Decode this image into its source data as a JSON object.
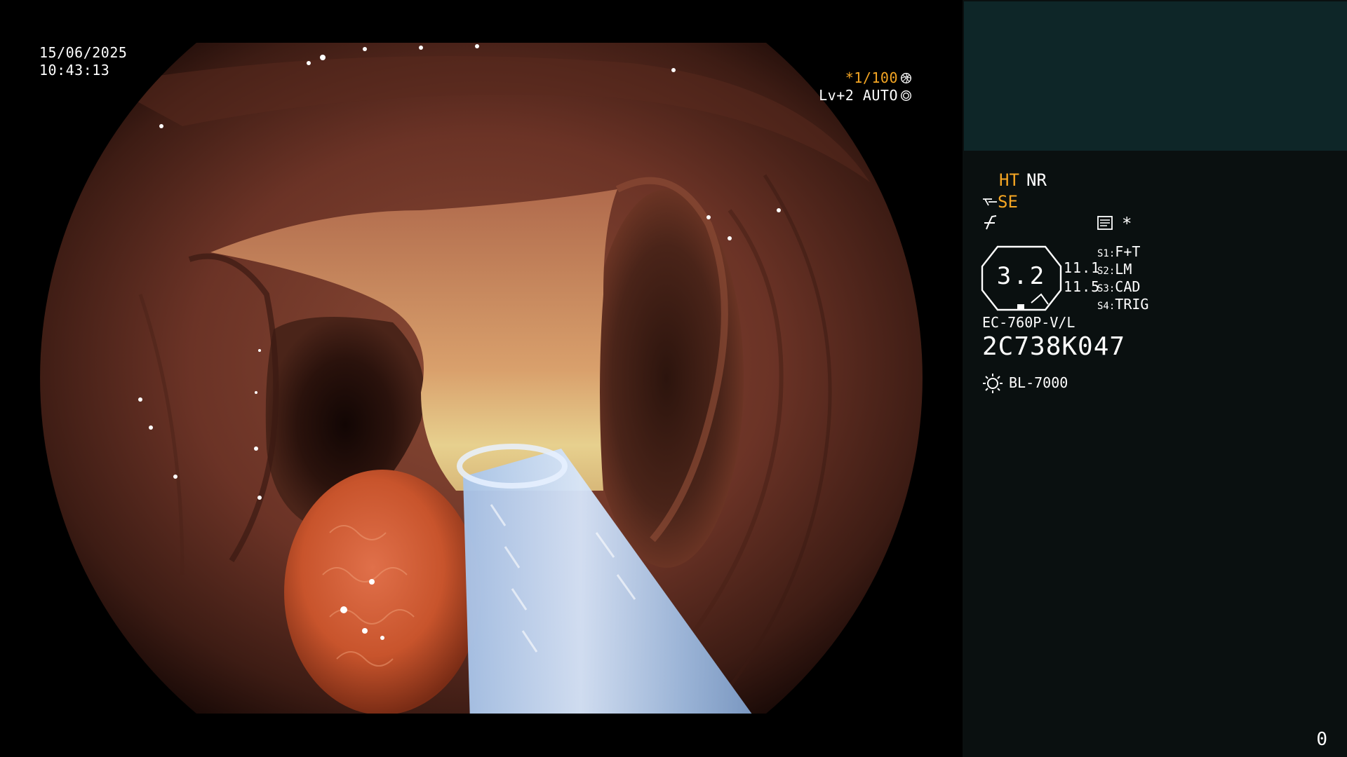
{
  "overlay": {
    "date": "15/06/2025",
    "time": "10:43:13",
    "shutter_prefix": "*",
    "shutter_value": "1/100",
    "iris_level": "Lv+2",
    "iris_mode": "AUTO",
    "shutter_icon": "aperture-icon",
    "iris_icon": "iris-icon"
  },
  "panel": {
    "ht_label": "HT",
    "nr_label": "NR",
    "se_label": "SE",
    "enhancement_icon": "enhancement-icon",
    "memo_icon": "memo-icon",
    "star_mark": "*",
    "zoom_value": "3.2",
    "value_top": "11.1",
    "value_bottom": "11.5",
    "switches": [
      {
        "key": "S1:",
        "value": "F+T"
      },
      {
        "key": "S2:",
        "value": "LM"
      },
      {
        "key": "S3:",
        "value": "CAD"
      },
      {
        "key": "S4:",
        "value": "TRIG"
      }
    ],
    "scope_model": "EC-760P-V/L",
    "scope_serial": "2C738K047",
    "light_icon": "sun-icon",
    "light_source": "BL-7000",
    "page_counter": "0"
  },
  "colors": {
    "accent_amber": "#f5a623",
    "panel_bg": "#0a1010",
    "panel_header_bg": "#0e2628",
    "mucosa": "#6b3326",
    "polyp": "#c8542c",
    "cap": "#9fbbe0"
  }
}
